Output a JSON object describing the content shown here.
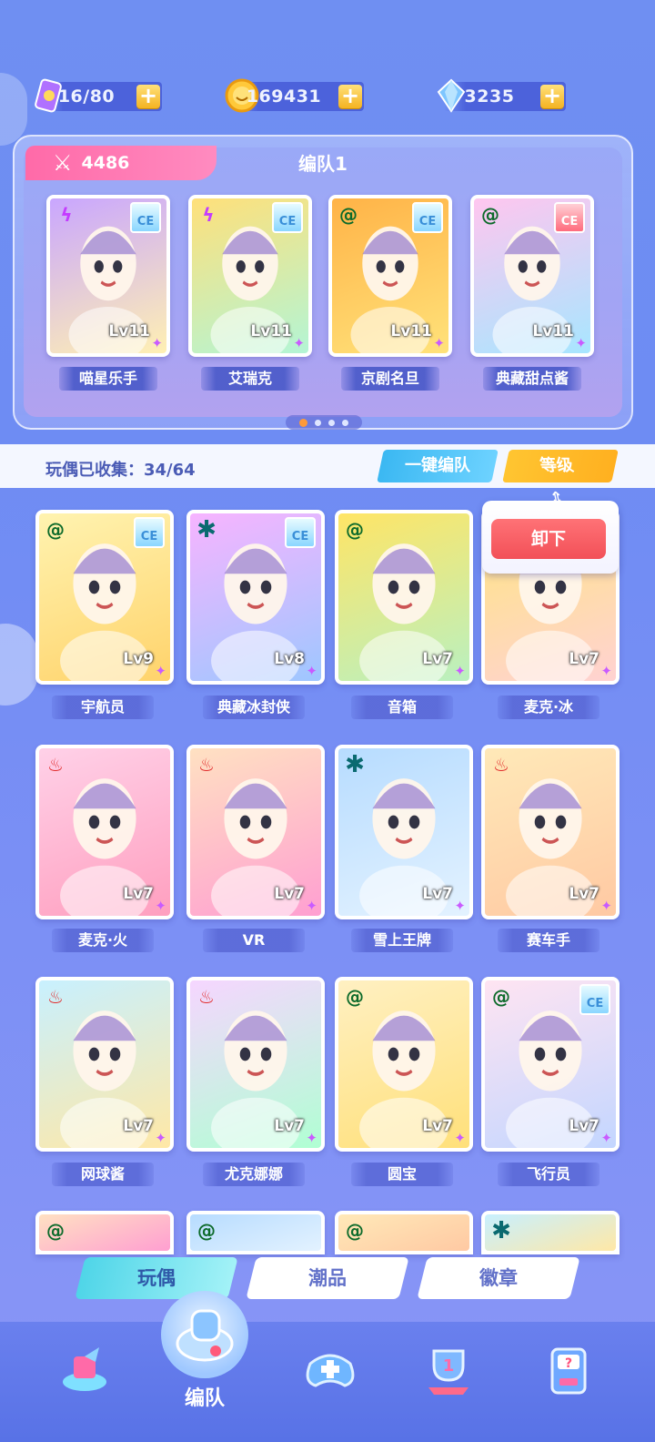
{
  "currency": {
    "ticket": {
      "value": "16/80",
      "icon": "ticket-icon"
    },
    "coin": {
      "value": "169431",
      "icon": "coin-icon"
    },
    "gem": {
      "value": "3235",
      "icon": "gem-icon"
    },
    "plus": "+"
  },
  "team": {
    "power": "4486",
    "title": "编队1",
    "members": [
      {
        "name": "喵星乐手",
        "level": "Lv11",
        "element": "lightning",
        "badge": "CE"
      },
      {
        "name": "艾瑞克",
        "level": "Lv11",
        "element": "lightning",
        "badge": "CE"
      },
      {
        "name": "京剧名旦",
        "level": "Lv11",
        "element": "spiral",
        "badge": "CE"
      },
      {
        "name": "典藏甜点酱",
        "level": "Lv11",
        "element": "spiral",
        "badge": "CE"
      }
    ]
  },
  "collection": {
    "label": "玩偶已收集：34/64",
    "one_key_button": "一键编队",
    "sort_button": "等级"
  },
  "popup": {
    "unload": "卸下"
  },
  "dolls": [
    {
      "name": "宇航员",
      "level": "Lv9",
      "element": "spiral",
      "badge": "CE"
    },
    {
      "name": "典藏冰封侠",
      "level": "Lv8",
      "element": "star",
      "badge": "CE"
    },
    {
      "name": "音箱",
      "level": "Lv7",
      "element": "spiral",
      "badge": ""
    },
    {
      "name": "麦克·冰",
      "level": "Lv7",
      "element": "",
      "badge": ""
    },
    {
      "name": "麦克·火",
      "level": "Lv7",
      "element": "fire",
      "badge": ""
    },
    {
      "name": "VR",
      "level": "Lv7",
      "element": "fire",
      "badge": ""
    },
    {
      "name": "雪上王牌",
      "level": "Lv7",
      "element": "star",
      "badge": ""
    },
    {
      "name": "赛车手",
      "level": "Lv7",
      "element": "fire",
      "badge": ""
    },
    {
      "name": "网球酱",
      "level": "Lv7",
      "element": "fire",
      "badge": ""
    },
    {
      "name": "尤克娜娜",
      "level": "Lv7",
      "element": "fire",
      "badge": ""
    },
    {
      "name": "圆宝",
      "level": "Lv7",
      "element": "spiral",
      "badge": ""
    },
    {
      "name": "飞行员",
      "level": "Lv7",
      "element": "spiral",
      "badge": "CE"
    }
  ],
  "tabs": [
    "玩偶",
    "潮品",
    "徽章"
  ],
  "bottom_nav": {
    "center_label": "编队",
    "icons": [
      "gift-arrow-icon",
      "whistle-icon",
      "gamepad-icon",
      "trophy-icon",
      "mystery-machine-icon"
    ]
  },
  "colors": {
    "background": "#6f8ff2",
    "power_tag": "#ff6aa8",
    "one_key": "#3bb8f2",
    "sort": "#ffc531",
    "unload": "#f25058",
    "tab_active": "#4fd5e8"
  }
}
